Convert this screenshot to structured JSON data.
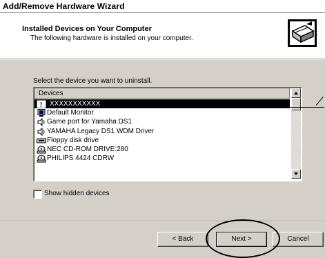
{
  "window": {
    "title": "Add/Remove Hardware Wizard"
  },
  "header": {
    "heading": "Installed Devices on Your Computer",
    "subheading": "The following hardware is installed on your computer.",
    "icon": "hardware-wizard-icon"
  },
  "main": {
    "prompt": "Select the device you want to uninstall.",
    "list": {
      "column_header": "Devices",
      "selected_index": 0,
      "items": [
        {
          "label": "XXXXXXXXXXX",
          "icon": "unknown-device-icon"
        },
        {
          "label": "Default Monitor",
          "icon": "monitor-icon"
        },
        {
          "label": "Game port for Yamaha DS1",
          "icon": "sound-device-icon"
        },
        {
          "label": "YAMAHA Legacy DS1 WDM Driver",
          "icon": "sound-device-icon"
        },
        {
          "label": "Floppy disk drive",
          "icon": "floppy-drive-icon"
        },
        {
          "label": "NEC CD-ROM DRIVE:280",
          "icon": "cdrom-icon"
        },
        {
          "label": "PHILIPS 4424 CDRW",
          "icon": "cdrom-icon"
        }
      ]
    },
    "show_hidden_label": "Show hidden devices",
    "show_hidden_checked": false
  },
  "footer": {
    "back_label": "< Back",
    "next_label": "Next >",
    "cancel_label": "Cancel"
  }
}
